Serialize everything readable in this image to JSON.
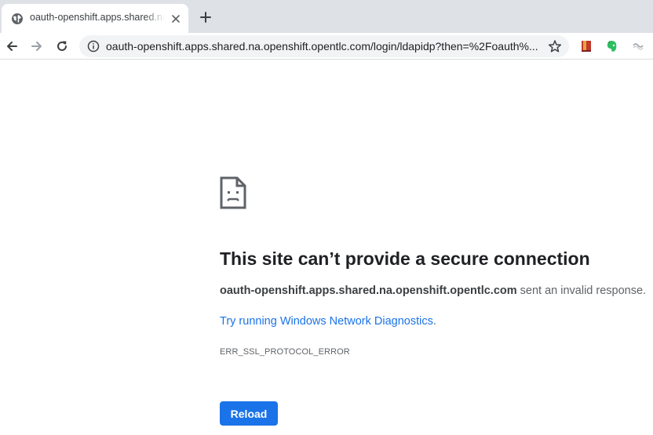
{
  "browser": {
    "tab": {
      "title": "oauth-openshift.apps.shared.na.openshift.opentlc.com"
    },
    "omnibox": {
      "url": "oauth-openshift.apps.shared.na.openshift.opentlc.com/login/ldapidp?then=%2Foauth%..."
    },
    "icons": {
      "tab_favicon": "globe-icon",
      "tab_close": "close-icon",
      "new_tab": "plus-icon",
      "back": "arrow-left-icon",
      "forward": "arrow-right-icon",
      "reload": "reload-icon",
      "site_info": "info-icon",
      "bookmark": "star-icon",
      "extension_1": "book-icon",
      "extension_2": "evernote-icon",
      "extension_3": "extension-icon"
    }
  },
  "error_page": {
    "headline": "This site can’t provide a secure connection",
    "host": "oauth-openshift.apps.shared.na.openshift.opentlc.com",
    "message": "sent an invalid response.",
    "diagnostics_link": "Try running Windows Network Diagnostics",
    "diagnostics_suffix": ".",
    "error_code": "ERR_SSL_PROTOCOL_ERROR",
    "reload_label": "Reload",
    "icon": "sad-document-icon"
  },
  "colors": {
    "tabstrip_bg": "#dee1e6",
    "link": "#1a73e8",
    "button_bg": "#1a73e8",
    "headline": "#202124",
    "body_text": "#5f6368"
  }
}
